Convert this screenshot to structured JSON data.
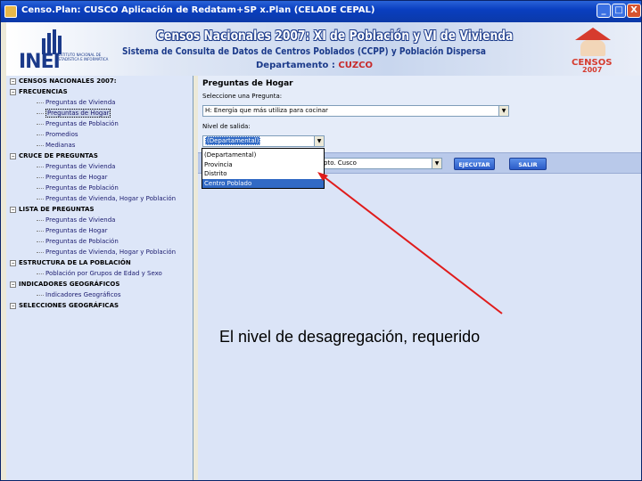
{
  "window": {
    "title": "Censo.Plan: CUSCO   Aplicación de Redatam+SP x.Plan (CELADE CEPAL)",
    "controls": {
      "minimize": "_",
      "maximize": "□",
      "close": "X"
    }
  },
  "banner": {
    "logo_text": "INEI",
    "logo_subtext": "INSTITUTO NACIONAL DE ESTADÍSTICA E INFORMÁTICA",
    "title": "Censos Nacionales 2007: XI de Población y VI de Vivienda",
    "subtitle": "Sistema de Consulta de Datos de Centros Poblados (CCPP) y Población Dispersa",
    "departamento_label": "Departamento :",
    "departamento_value": "CUZCO",
    "censos_logo": {
      "line1": "CENSOS",
      "line2": "2007"
    }
  },
  "tree": {
    "items": [
      {
        "kind": "section",
        "label": "CENSOS NACIONALES 2007:"
      },
      {
        "kind": "section",
        "label": "FRECUENCIAS"
      },
      {
        "kind": "leaf",
        "label": "Preguntas de Vivienda"
      },
      {
        "kind": "leaf",
        "label": "Preguntas de Hogar",
        "selected": true
      },
      {
        "kind": "leaf",
        "label": "Preguntas de Población"
      },
      {
        "kind": "leaf",
        "label": "Promedios"
      },
      {
        "kind": "leaf",
        "label": "Medianas"
      },
      {
        "kind": "section",
        "label": "CRUCE DE PREGUNTAS"
      },
      {
        "kind": "leaf",
        "label": "Preguntas de Vivienda"
      },
      {
        "kind": "leaf",
        "label": "Preguntas de Hogar"
      },
      {
        "kind": "leaf",
        "label": "Preguntas de Población"
      },
      {
        "kind": "leaf",
        "label": "Preguntas de Vivienda, Hogar y Población"
      },
      {
        "kind": "section",
        "label": "LISTA DE PREGUNTAS"
      },
      {
        "kind": "leaf",
        "label": "Preguntas de Vivienda"
      },
      {
        "kind": "leaf",
        "label": "Preguntas de Hogar"
      },
      {
        "kind": "leaf",
        "label": "Preguntas de Población"
      },
      {
        "kind": "leaf",
        "label": "Preguntas de Vivienda, Hogar y Población"
      },
      {
        "kind": "section",
        "label": "ESTRUCTURA DE LA POBLACIÓN"
      },
      {
        "kind": "leaf",
        "label": "Población por Grupos de Edad y Sexo"
      },
      {
        "kind": "section",
        "label": "INDICADORES GEOGRÁFICOS"
      },
      {
        "kind": "leaf",
        "label": "Indicadores Geográficos"
      },
      {
        "kind": "section",
        "label": "SELECCIONES GEOGRÁFICAS"
      }
    ]
  },
  "form": {
    "header": "Preguntas de Hogar",
    "pregunta_label": "Seleccione una Pregunta:",
    "pregunta_value": "H: Energía que más utiliza para cocinar",
    "nivel_label": "Nivel de salida:",
    "nivel_value": "(Departamental)",
    "filtro_value": "pto. Cusco",
    "nivel_options": [
      "(Departamental)",
      "Provincia",
      "Distrito",
      "Centro Poblado"
    ],
    "nivel_highlighted": "Centro Poblado",
    "ejecutar_label": "EJECUTAR",
    "salir_label": "SALIR"
  },
  "annotation": {
    "caption": "El nivel de desagregación, requerido",
    "arrow_color": "#e01b1b"
  }
}
